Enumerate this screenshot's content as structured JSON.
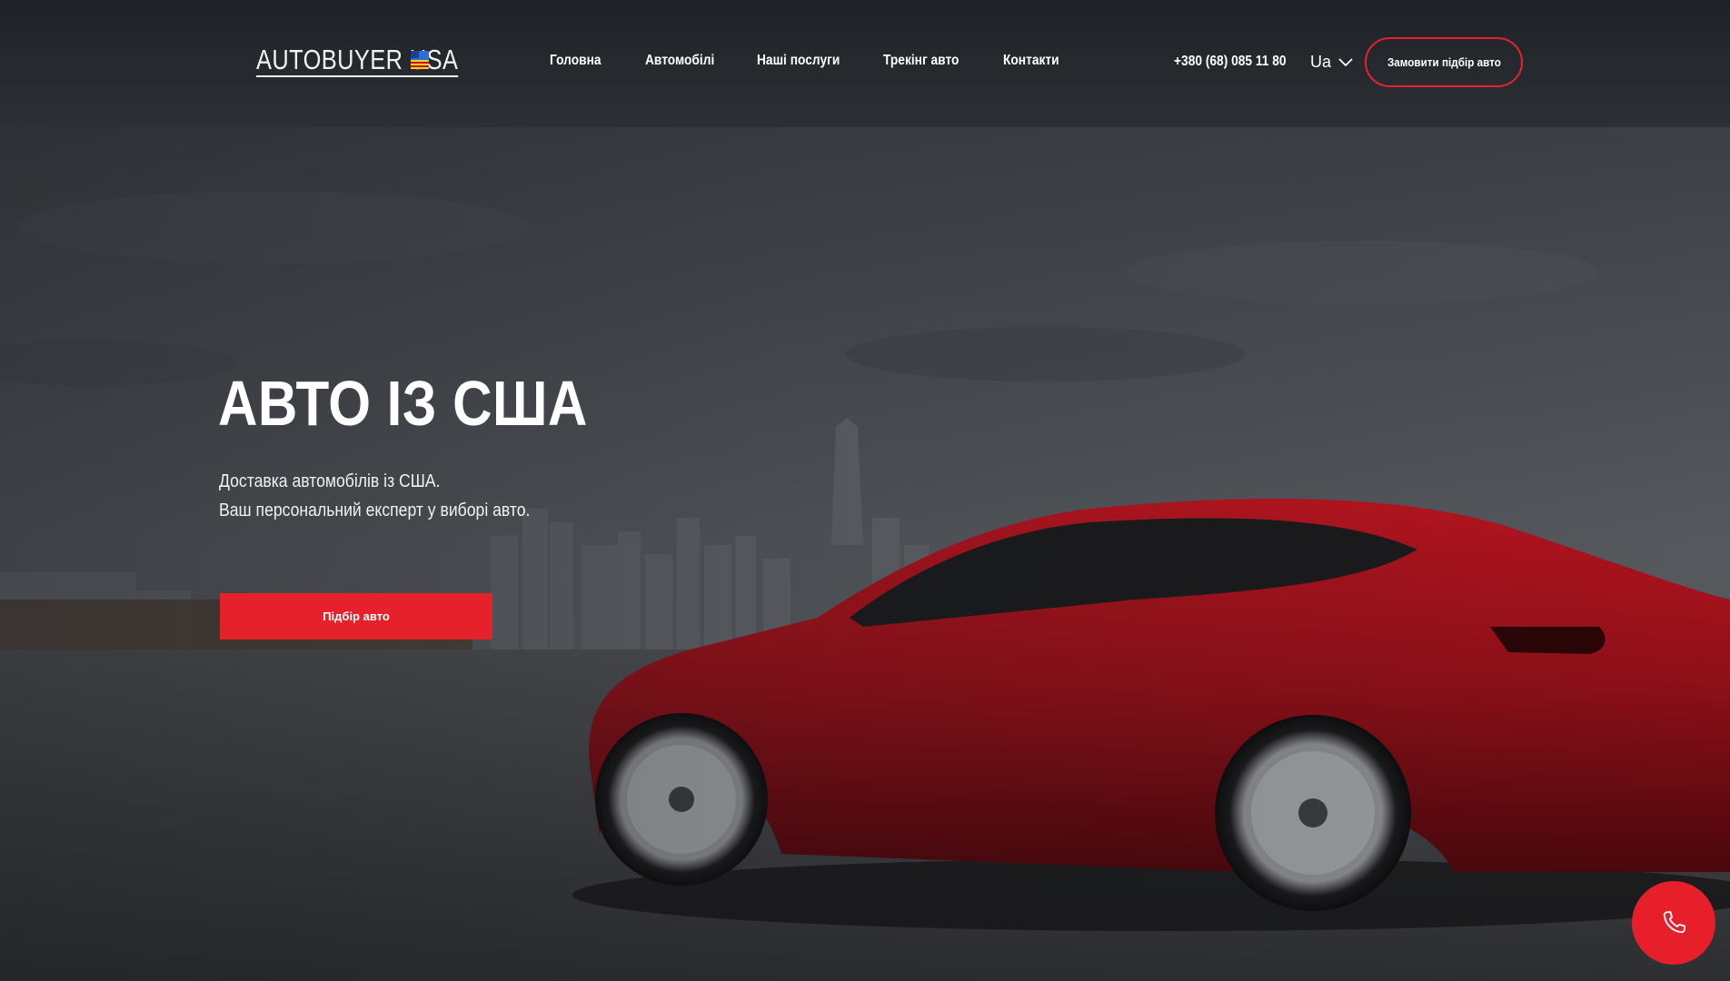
{
  "brand": {
    "name": "AUTOBUYER USA"
  },
  "nav": {
    "items": [
      {
        "label": "Головна"
      },
      {
        "label": "Автомобілі"
      },
      {
        "label": "Наші послуги"
      },
      {
        "label": "Трекінг авто"
      },
      {
        "label": "Контакти"
      }
    ]
  },
  "header": {
    "phone": "+380 (68) 085 11 80",
    "language": "Ua",
    "cta_label": "Замовити підбір авто"
  },
  "hero": {
    "title": "АВТО ІЗ США",
    "subtitle_line1": "Доставка автомобілів із США.",
    "subtitle_line2": "Ваш персональний експерт у виборі авто.",
    "button_label": "Підбір авто"
  },
  "colors": {
    "accent": "#e5222b",
    "header_bg": "#24272b",
    "car_red": "#a3121d"
  },
  "icons": {
    "flag": "us-ukraine-flag-icon",
    "language_dropdown": "chevron-down-icon",
    "call": "phone-icon"
  }
}
